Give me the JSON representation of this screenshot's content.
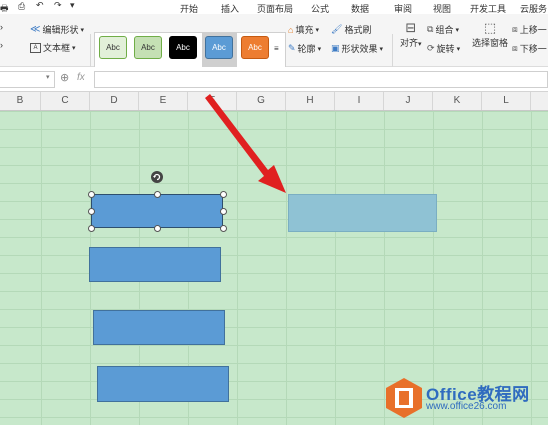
{
  "menu": {
    "tabs": [
      "开始",
      "插入",
      "页面布局",
      "公式",
      "数据",
      "审阅",
      "视图",
      "开发工具",
      "云服务"
    ]
  },
  "ribbon": {
    "edit_shape": "编辑形状",
    "text_box": "文本框",
    "style_swatches": [
      {
        "label": "Abc",
        "bg": "#e2f0d9",
        "fg": "#333333",
        "border": "#70ad47"
      },
      {
        "label": "Abc",
        "bg": "#c5e0b4",
        "fg": "#333333",
        "border": "#70ad47"
      },
      {
        "label": "Abc",
        "bg": "#000000",
        "fg": "#ffffff",
        "border": "#000000"
      },
      {
        "label": "Abc",
        "bg": "#5b9bd5",
        "fg": "#ffffff",
        "border": "#41719c"
      },
      {
        "label": "Abc",
        "bg": "#ed7d31",
        "fg": "#ffffff",
        "border": "#c55a11"
      }
    ],
    "fill": "填充",
    "format_brush": "格式刷",
    "outline": "轮廓",
    "shape_effects": "形状效果",
    "align": "对齐",
    "group": "组合",
    "rotate": "旋转",
    "selection_pane": "选择窗格",
    "bring_forward": "上移一",
    "send_backward": "下移一"
  },
  "formula_bar": {
    "fx": "fx",
    "value": ""
  },
  "columns": [
    "B",
    "C",
    "D",
    "E",
    "F",
    "G",
    "H",
    "I",
    "J",
    "K",
    "L"
  ],
  "watermark": {
    "title": "Office教程网",
    "url": "www.office26.com"
  },
  "colors": {
    "sheet_bg": "#c7e8cb",
    "shape_fill": "#5b9bd5",
    "ghost_fill": "#8fc2d4",
    "arrow": "#e02020",
    "watermark_orange": "#e8702a"
  }
}
